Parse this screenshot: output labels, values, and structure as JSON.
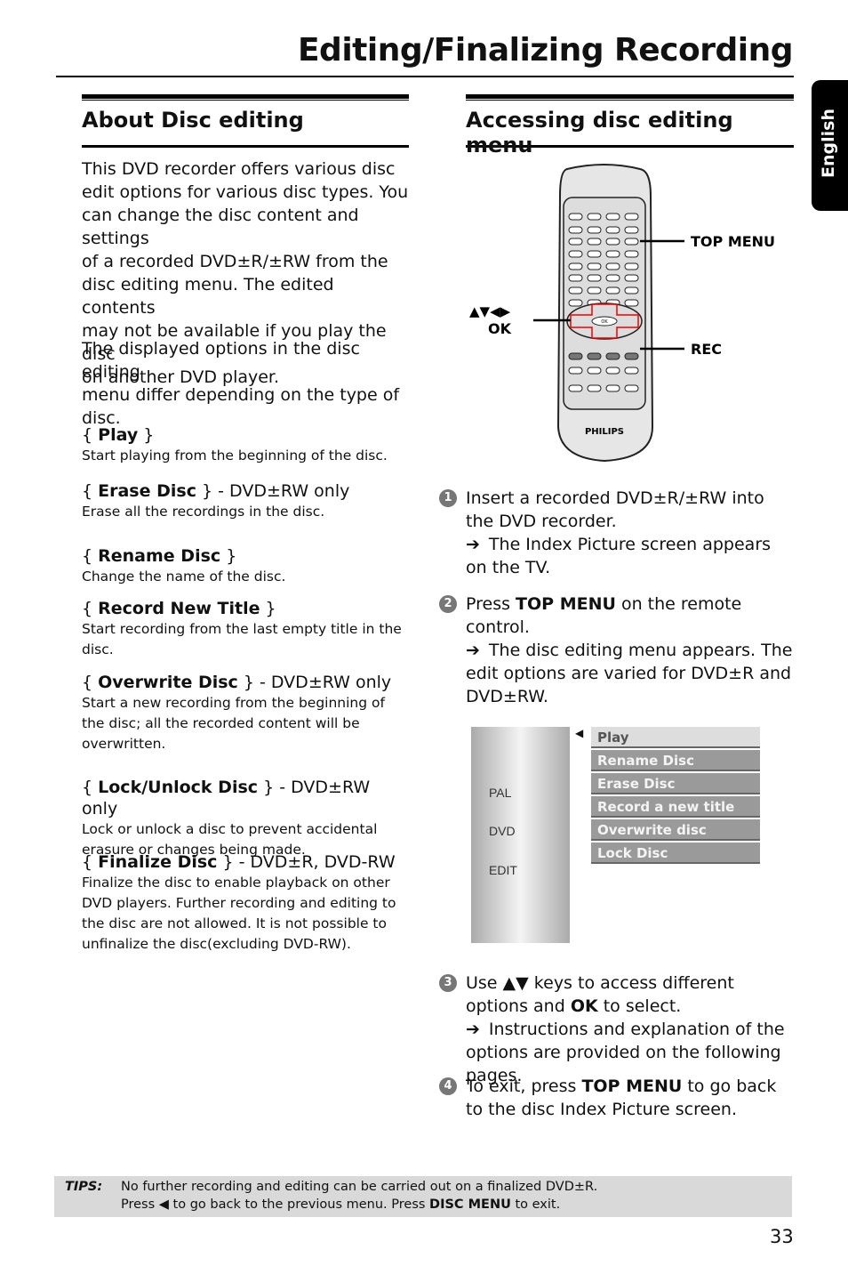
{
  "header": {
    "title": "Editing/Finalizing Recording"
  },
  "language_tab": "English",
  "left": {
    "heading": "About Disc editing",
    "para1": [
      "This DVD recorder offers various disc",
      "edit options for various disc types. You",
      "can change the disc content and settings",
      "of a recorded DVD±R/±RW from the",
      "disc editing menu. The edited contents",
      "may not be available if you play the disc",
      "on another DVD player."
    ],
    "para2": [
      "The displayed options in the disc editing",
      "menu differ depending on the type of",
      "disc."
    ],
    "items": [
      {
        "name": "Play",
        "suffix": "",
        "desc": "Start playing from the beginning of the disc."
      },
      {
        "name": "Erase Disc",
        "suffix": " - DVD±RW only",
        "desc": "Erase all the recordings in the disc."
      },
      {
        "name": "Rename Disc",
        "suffix": "",
        "desc": "Change the name of the disc."
      },
      {
        "name": "Record New Title",
        "suffix": "",
        "desc": "Start recording from the last empty title in the disc."
      },
      {
        "name": "Overwrite Disc",
        "suffix": " - DVD±RW only",
        "desc": "Start a new recording from the beginning of the disc; all the recorded content will be overwritten."
      },
      {
        "name": "Lock/Unlock Disc",
        "suffix": " - DVD±RW only",
        "desc": "Lock or unlock a disc to prevent accidental erasure or changes being made."
      },
      {
        "name": "Finalize Disc",
        "suffix": " - DVD±R, DVD-RW",
        "desc": "Finalize the disc to enable playback on other DVD players. Further recording and editing to the disc are not allowed. It is not possible to unfinalize the disc(excluding DVD-RW)."
      }
    ]
  },
  "right": {
    "heading": "Accessing disc editing menu",
    "remote": {
      "brand": "PHILIPS",
      "label_top_menu": "TOP MENU",
      "label_rec": "REC",
      "label_arrows": "▲▼◀▶",
      "label_ok": "OK",
      "ok_button": "OK"
    },
    "steps": [
      {
        "num": "1",
        "pre": "Insert a recorded DVD±R/±RW into the DVD recorder.",
        "bold": "",
        "post": "",
        "result": "The Index Picture screen appears on the TV."
      },
      {
        "num": "2",
        "pre": "Press ",
        "bold": "TOP MENU",
        "post": " on the remote control.",
        "result": "The disc editing menu appears. The edit options are varied for DVD±R and DVD±RW."
      },
      {
        "num": "3",
        "pre": "Use ▲▼ keys to access different options and ",
        "bold": "OK",
        "post": " to select.",
        "result": "Instructions and explanation of the options are provided on the following pages."
      },
      {
        "num": "4",
        "pre": "To exit, press ",
        "bold": "TOP MENU",
        "post": " to go back to the disc Index Picture screen.",
        "result": ""
      }
    ],
    "osd": {
      "side": [
        "PAL",
        "DVD",
        "EDIT"
      ],
      "menu": [
        "Play",
        "Rename Disc",
        "Erase Disc",
        "Record a new title",
        "Overwrite disc",
        "Lock Disc"
      ],
      "selected": "Play"
    }
  },
  "tips": {
    "label": "TIPS:",
    "line1": "No further recording and editing can be carried out on a finalized DVD±R.",
    "line2_pre": "Press ◀ to go back to the previous menu. Press ",
    "line2_bold": "DISC MENU",
    "line2_post": " to exit."
  },
  "page_number": "33"
}
